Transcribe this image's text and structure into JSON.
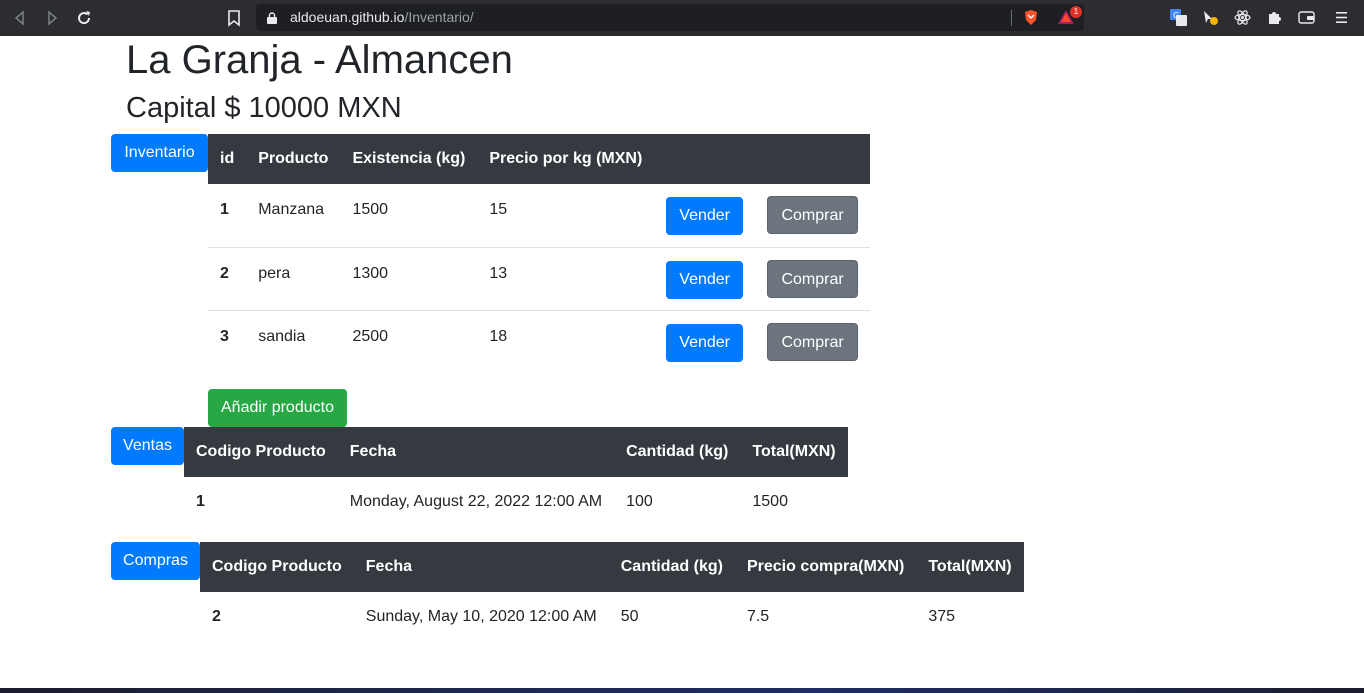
{
  "browser": {
    "url_host": "aldoeuan.github.io",
    "url_path": "/Inventario/",
    "rewards_badge": "1"
  },
  "header": {
    "title": "La Granja - Almancen",
    "capital": "Capital $ 10000 MXN"
  },
  "inventory": {
    "tab_label": "Inventario",
    "columns": [
      "id",
      "Producto",
      "Existencia (kg)",
      "Precio por kg (MXN)"
    ],
    "rows": [
      {
        "id": "1",
        "producto": "Manzana",
        "existencia": "1500",
        "precio": "15"
      },
      {
        "id": "2",
        "producto": "pera",
        "existencia": "1300",
        "precio": "13"
      },
      {
        "id": "3",
        "producto": "sandia",
        "existencia": "2500",
        "precio": "18"
      }
    ],
    "sell_label": "Vender",
    "buy_label": "Comprar",
    "add_label": "Añadir producto"
  },
  "sales": {
    "tab_label": "Ventas",
    "columns": [
      "Codigo Producto",
      "Fecha",
      "Cantidad (kg)",
      "Total(MXN)"
    ],
    "rows": [
      {
        "codigo": "1",
        "fecha": "Monday, August 22, 2022 12:00 AM",
        "cantidad": "100",
        "total": "1500"
      }
    ]
  },
  "purchases": {
    "tab_label": "Compras",
    "columns": [
      "Codigo Producto",
      "Fecha",
      "Cantidad (kg)",
      "Precio compra(MXN)",
      "Total(MXN)"
    ],
    "rows": [
      {
        "codigo": "2",
        "fecha": "Sunday, May 10, 2020 12:00 AM",
        "cantidad": "50",
        "precio": "7.5",
        "total": "375"
      }
    ]
  },
  "colors": {
    "primary": "#007bff",
    "secondary": "#6c757d",
    "success": "#28a745",
    "table_header": "#343a40"
  },
  "icons": [
    "back-icon",
    "forward-icon",
    "reload-icon",
    "bookmark-icon",
    "lock-icon",
    "brave-shields-icon",
    "brave-rewards-icon",
    "translate-icon",
    "extension-icon",
    "react-devtools-icon",
    "puzzle-extensions-icon",
    "wallet-icon",
    "menu-icon"
  ]
}
